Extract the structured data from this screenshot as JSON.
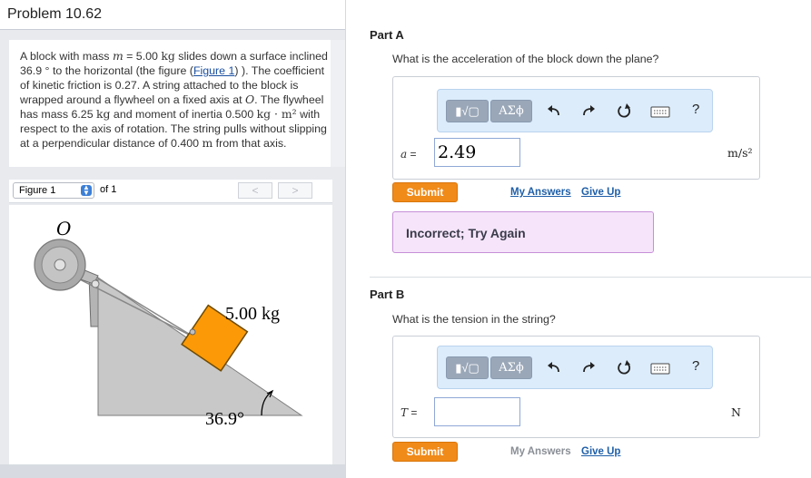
{
  "problem": {
    "title": "Problem 10.62",
    "statement": {
      "p1": "A block with mass",
      "mass_var": "m",
      "p2": " = 5.00 ",
      "mass_unit": "kg",
      "p3": " slides down a surface inclined 36.9 ° to the horizontal (the figure (",
      "figure_link": "Figure 1",
      "p4": ") ). The coefficient of kinetic friction is 0.27. A string attached to the block is wrapped around a flywheel on a fixed axis at ",
      "axis_var": "O",
      "p5": ". The flywheel has mass 6.25 ",
      "mass_unit2": "kg",
      "p6": " and moment of inertia 0.500 ",
      "inertia_unit": "kg · m²",
      "p7": " with respect to the axis of rotation. The string pulls without slipping at a perpendicular distance of 0.400 ",
      "dist_unit": "m",
      "p8": " from that axis."
    }
  },
  "figure_nav": {
    "selected": "Figure 1",
    "of_label": "of 1",
    "prev": "<",
    "next": ">"
  },
  "figure": {
    "axis_label": "O",
    "mass_label": "5.00 kg",
    "angle_label": "36.9°",
    "colors": {
      "block": "#fb9a06",
      "ramp": "#c8c8c8",
      "wheel": "#a9a9a9"
    }
  },
  "toolbar": {
    "templates_label": "▮√▢",
    "greek_label": "ΑΣϕ",
    "icons": [
      "undo-icon",
      "redo-icon",
      "reset-icon",
      "keyboard-icon",
      "help-icon"
    ],
    "help_label": "?"
  },
  "part_a": {
    "title": "Part A",
    "question": "What is the acceleration of the block down the plane?",
    "var": "a",
    "eq": " =",
    "value": "2.49",
    "unit": "m/s²",
    "submit": "Submit",
    "my_answers": "My Answers",
    "give_up": "Give Up",
    "feedback": "Incorrect; Try Again"
  },
  "part_b": {
    "title": "Part B",
    "question": "What is the tension in the string?",
    "var": "T",
    "eq": " =",
    "value": "",
    "unit": "N",
    "submit": "Submit",
    "my_answers": "My Answers",
    "give_up": "Give Up"
  },
  "colors": {
    "accent": "#f08a19",
    "link": "#1f5fa8",
    "toolbar_bg": "#dcecfb",
    "feedback_bg": "#f6e5fa"
  }
}
